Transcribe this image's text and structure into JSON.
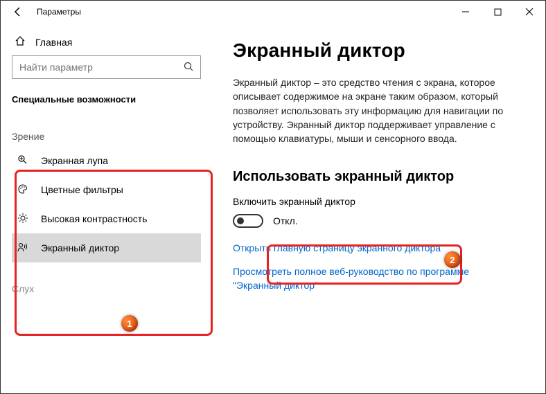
{
  "window": {
    "title": "Параметры"
  },
  "sidebar": {
    "home": "Главная",
    "search_placeholder": "Найти параметр",
    "section": "Специальные возможности",
    "group_vision": "Зрение",
    "items": [
      {
        "label": "Экранная лупа"
      },
      {
        "label": "Цветные фильтры"
      },
      {
        "label": "Высокая контрастность"
      },
      {
        "label": "Экранный диктор"
      }
    ],
    "group_hearing": "Слух"
  },
  "main": {
    "heading": "Экранный диктор",
    "description": "Экранный диктор – это средство чтения с экрана, которое описывает содержимое на экране таким образом, который позволяет использовать эту информацию для навигации по устройству. Экранный диктор поддерживает управление с помощью клавиатуры, мыши и сенсорного ввода.",
    "use_heading": "Использовать экранный диктор",
    "toggle_label": "Включить экранный диктор",
    "toggle_state": "Откл.",
    "link1": "Открыть главную страницу экранного диктора",
    "link2": "Просмотреть полное веб-руководство по программе \"Экранный диктор\""
  },
  "callouts": {
    "one": "1",
    "two": "2"
  }
}
